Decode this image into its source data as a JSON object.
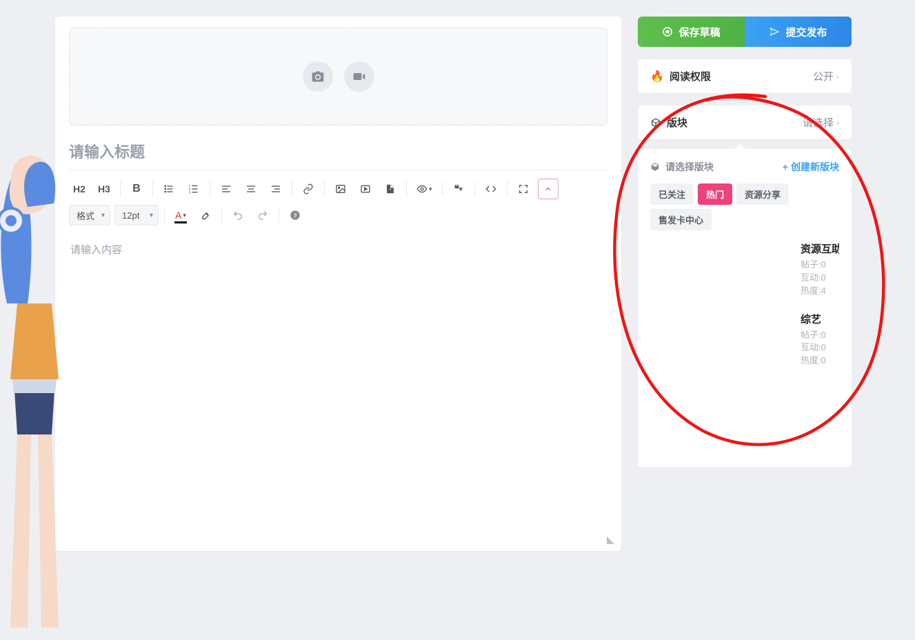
{
  "upload": {
    "photo_label": "照片",
    "video_label": "视频"
  },
  "editor": {
    "title_placeholder": "请输入标题",
    "content_placeholder": "请输入内容",
    "format_select": "格式",
    "size_select": "12pt",
    "h2": "H2",
    "h3": "H3"
  },
  "actions": {
    "save_draft": "保存草稿",
    "submit_publish": "提交发布"
  },
  "settings": {
    "read_perm_label": "阅读权限",
    "read_perm_value": "公开",
    "forum_label": "版块",
    "forum_value": "请选择"
  },
  "forum_panel": {
    "header": "请选择版块",
    "create_label": "创建新版块",
    "tabs": [
      "已关注",
      "热门",
      "资源分享",
      "售发卡中心"
    ],
    "active_tab_index": 1,
    "items": [
      {
        "name": "资源互助",
        "posts_label": "帖子:",
        "posts": 0,
        "interact_label": "互动:",
        "interact": 0,
        "heat_label": "热度:",
        "heat": 4
      },
      {
        "name": "综艺",
        "posts_label": "帖子:",
        "posts": 0,
        "interact_label": "互动:",
        "interact": 0,
        "heat_label": "热度:",
        "heat": 0
      }
    ]
  }
}
